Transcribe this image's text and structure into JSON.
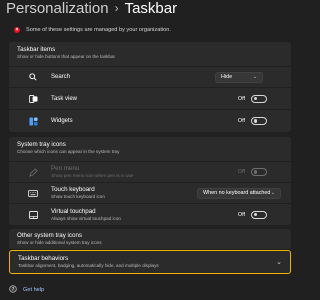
{
  "breadcrumb": {
    "parent": "Personalization",
    "separator": "›",
    "current": "Taskbar"
  },
  "notice": {
    "icon": "x-circle-icon",
    "text": "Some of these settings are managed by your organization."
  },
  "taskbar_items": {
    "title": "Taskbar items",
    "subtitle": "Show or hide buttons that appear on the taskbar",
    "rows": [
      {
        "icon": "search-icon",
        "label": "Search",
        "control": "select",
        "value": "Hide"
      },
      {
        "icon": "task-view-icon",
        "label": "Task view",
        "control": "toggle",
        "state": "Off"
      },
      {
        "icon": "widgets-icon",
        "label": "Widgets",
        "control": "toggle",
        "state": "Off"
      }
    ]
  },
  "system_tray_icons": {
    "title": "System tray icons",
    "subtitle": "Choose which icons can appear in the system tray",
    "rows": [
      {
        "icon": "pen-icon",
        "title": "Pen menu",
        "subtitle": "Show pen menu icon when pen is in use",
        "control": "toggle",
        "state": "Off",
        "disabled": true
      },
      {
        "icon": "keyboard-icon",
        "title": "Touch keyboard",
        "subtitle": "Show touch keyboard icon",
        "control": "select",
        "value": "When no keyboard attached"
      },
      {
        "icon": "touchpad-icon",
        "title": "Virtual touchpad",
        "subtitle": "Always show virtual touchpad icon",
        "control": "toggle",
        "state": "Off"
      }
    ]
  },
  "other_tray": {
    "title": "Other system tray icons",
    "subtitle": "Show or hide additional system tray icons"
  },
  "behaviors": {
    "title": "Taskbar behaviors",
    "subtitle": "Taskbar alignment, badging, automatically hide, and multiple displays"
  },
  "help": {
    "label": "Get help"
  },
  "colors": {
    "accent_focus": "#f0b400",
    "error": "#e81123",
    "link": "#a5c8ff"
  }
}
